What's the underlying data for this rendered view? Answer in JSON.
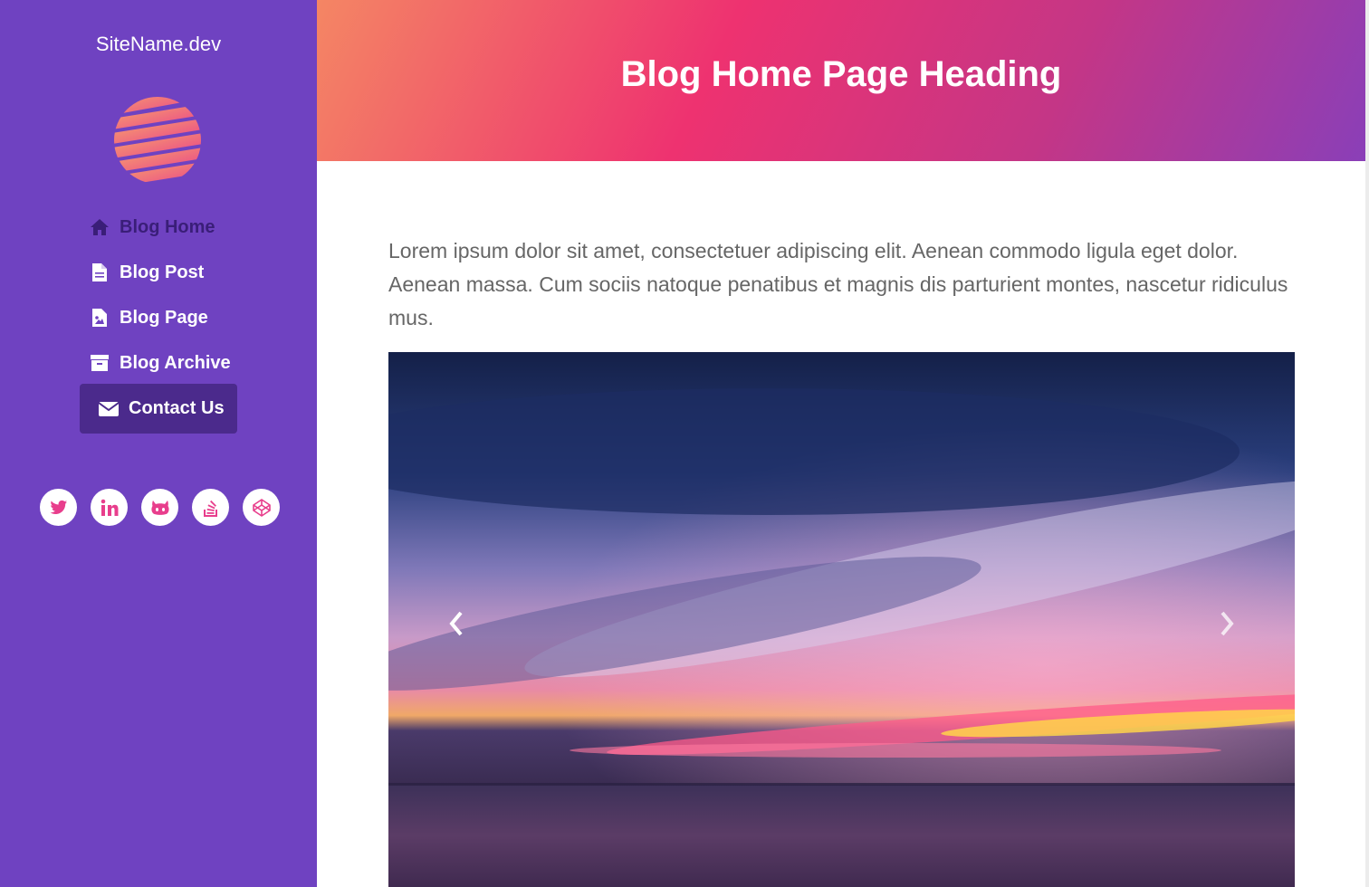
{
  "site": {
    "name": "SiteName.dev"
  },
  "nav": {
    "items": [
      {
        "label": "Blog Home",
        "icon": "home-icon"
      },
      {
        "label": "Blog Post",
        "icon": "file-icon"
      },
      {
        "label": "Blog Page",
        "icon": "file-image-icon"
      },
      {
        "label": "Blog Archive",
        "icon": "archive-icon"
      },
      {
        "label": "Contact Us",
        "icon": "envelope-icon"
      }
    ]
  },
  "socials": [
    "twitter-icon",
    "linkedin-icon",
    "github-icon",
    "stackoverflow-icon",
    "codepen-icon"
  ],
  "header": {
    "title": "Blog Home Page Heading"
  },
  "main": {
    "intro": "Lorem ipsum dolor sit amet, consectetuer adipiscing elit. Aenean commodo ligula eget dolor. Aenean massa. Cum sociis natoque penatibus et magnis dis parturient montes, nascetur ridiculus mus."
  },
  "colors": {
    "sidebar": "#6f42c1",
    "active_nav": "#4b2a8c",
    "accent": "#e83e8c"
  }
}
